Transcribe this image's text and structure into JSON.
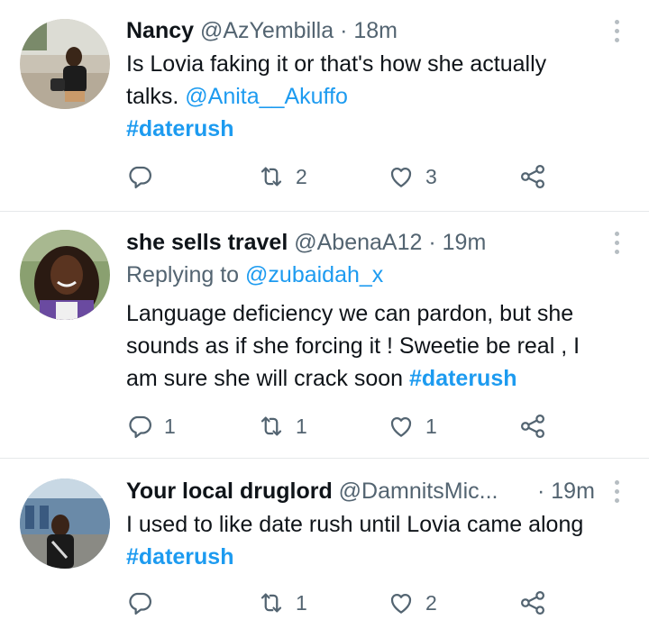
{
  "tweets": [
    {
      "name": "Nancy",
      "handle": "@AzYembilla",
      "separator": "·",
      "time": "18m",
      "reply_prefix": "",
      "reply_to": "",
      "text_lines": [
        "Is Lovia faking it or that's how she actually",
        "talks. "
      ],
      "mention": "@Anita__Akuffo",
      "hashtag": "#daterush",
      "reply_count": "",
      "retweet_count": "2",
      "like_count": "3"
    },
    {
      "name": "she sells travel",
      "handle": "@AbenaA12",
      "separator": "·",
      "time": "19m",
      "reply_prefix": "Replying to ",
      "reply_to": "@zubaidah_x",
      "text_lines": [
        "Language deficiency we can pardon, but she",
        "sounds as if she forcing it ! Sweetie be real , I",
        "am sure she will crack soon "
      ],
      "hashtag": "#daterush",
      "reply_count": "1",
      "retweet_count": "1",
      "like_count": "1"
    },
    {
      "name": "Your local druglord",
      "handle": "@DamnitsMic...",
      "separator": "·",
      "time": "19m",
      "text_lines": [
        "I used to like date rush until Lovia came along"
      ],
      "hashtag": "#daterush",
      "reply_count": "",
      "retweet_count": "1",
      "like_count": "2"
    }
  ],
  "icons": {
    "reply": "reply-icon",
    "retweet": "retweet-icon",
    "like": "heart-icon",
    "share": "share-icon",
    "more": "more-options-icon"
  },
  "colors": {
    "link": "#1d9bf0",
    "secondary_text": "#536471",
    "divider": "#e6e8ea"
  }
}
